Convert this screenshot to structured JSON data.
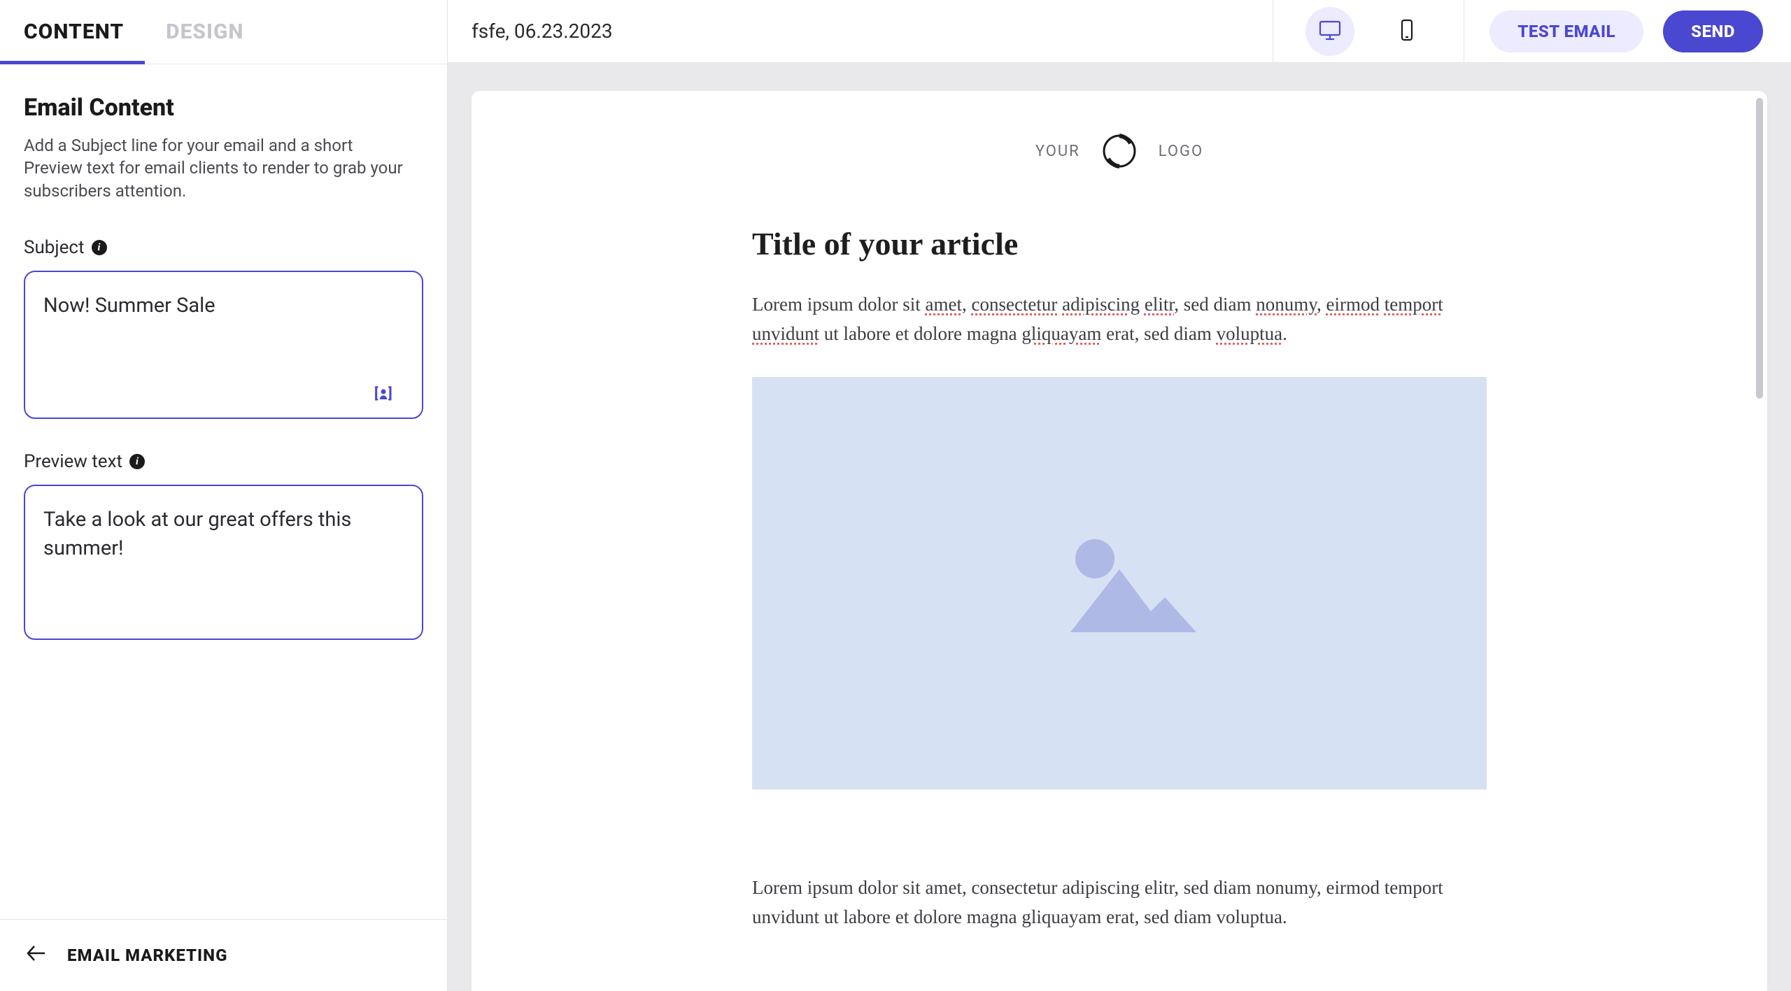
{
  "sidebar": {
    "tabs": {
      "content": "CONTENT",
      "design": "DESIGN"
    },
    "heading": "Email Content",
    "description": "Add a Subject line for your email and a short Preview text for email clients to render to grab your subscribers attention.",
    "subject_label": "Subject",
    "subject_value": "Now! Summer Sale",
    "preview_label": "Preview text",
    "preview_value": "Take a look at our great offers this summer!",
    "footer_label": "EMAIL MARKETING"
  },
  "topbar": {
    "doc_title": "fsfe, 06.23.2023",
    "test_label": "TEST EMAIL",
    "send_label": "SEND"
  },
  "email": {
    "logo_left": "YOUR",
    "logo_right": "LOGO",
    "article_title": "Title of your article",
    "para_plain_1a": "Lorem ipsum dolor sit ",
    "para_sp_1": "amet",
    "para_plain_1b": ", ",
    "para_sp_2": "consectetur",
    "para_plain_1c": " ",
    "para_sp_3": "adipiscing",
    "para_plain_1d": " ",
    "para_sp_4": "elitr",
    "para_plain_1e": ", sed diam ",
    "para_sp_5": "nonumy",
    "para_plain_1f": ", ",
    "para_sp_6": "eirmod",
    "para_plain_1g": " ",
    "para_sp_7": "temport",
    "para_plain_1h": " ",
    "para_sp_8": "unvidunt",
    "para_plain_1i": " ut labore et dolore magna ",
    "para_sp_9": "gliquayam",
    "para_plain_1j": " erat, sed diam ",
    "para_sp_10": "voluptua",
    "para_plain_1k": ".",
    "para2": "Lorem ipsum dolor sit amet, consectetur adipiscing elitr, sed diam nonumy, eirmod temport unvidunt ut labore et dolore magna gliquayam erat, sed diam voluptua."
  }
}
